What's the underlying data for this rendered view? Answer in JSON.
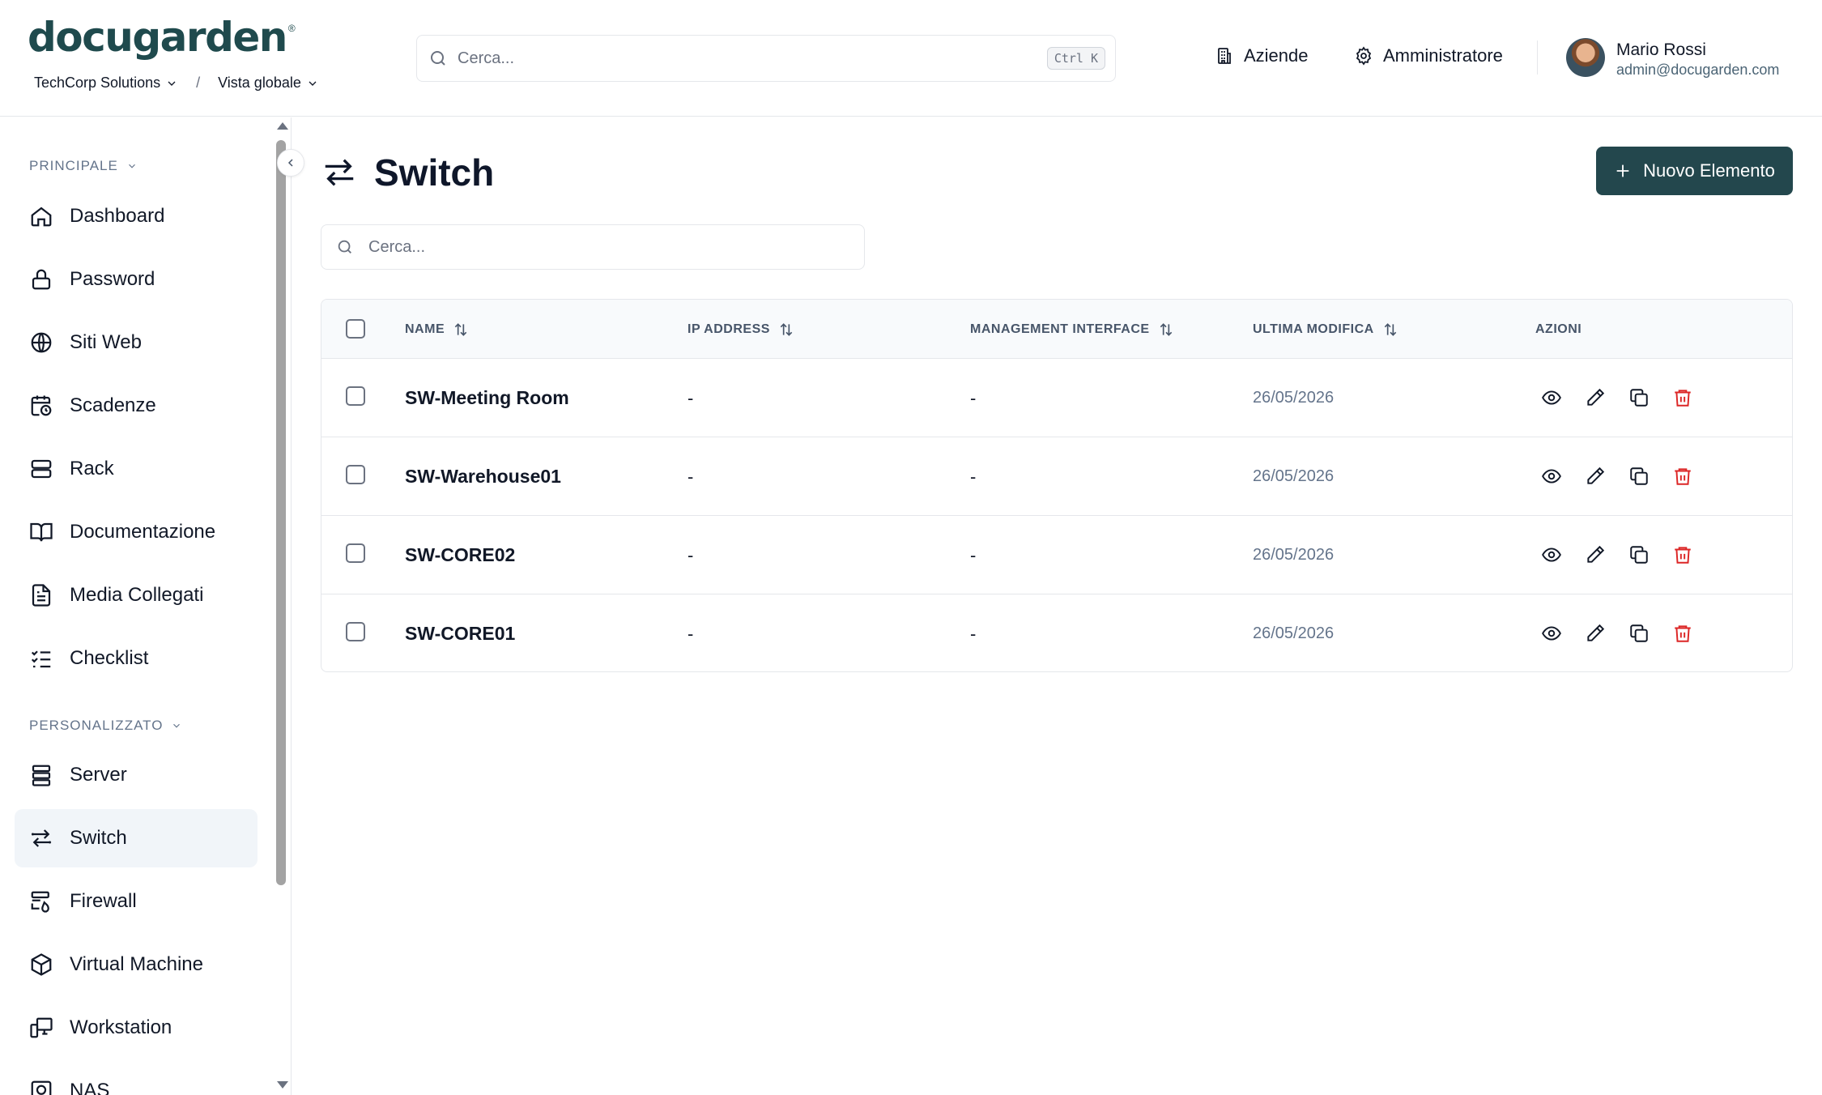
{
  "header": {
    "logo": "docugarden",
    "logo_mark": "®",
    "company": "TechCorp Solutions",
    "separator": "/",
    "view": "Vista globale",
    "search_placeholder": "Cerca...",
    "shortcut": "Ctrl K",
    "nav": [
      {
        "label": "Aziende",
        "icon": "building-icon"
      },
      {
        "label": "Amministratore",
        "icon": "gear-icon"
      }
    ],
    "user": {
      "name": "Mario Rossi",
      "email": "admin@docugarden.com"
    }
  },
  "sidebar": {
    "sections": [
      {
        "label": "PRINCIPALE",
        "items": [
          "Dashboard",
          "Password",
          "Siti Web",
          "Scadenze",
          "Rack",
          "Documentazione",
          "Media Collegati",
          "Checklist"
        ]
      },
      {
        "label": "PERSONALIZZATO",
        "items": [
          "Server",
          "Switch",
          "Firewall",
          "Virtual Machine",
          "Workstation",
          "NAS"
        ]
      }
    ],
    "active": "Switch"
  },
  "main": {
    "title": "Switch",
    "new_button": "Nuovo Elemento",
    "search_placeholder": "Cerca...",
    "table": {
      "columns": [
        "NAME",
        "IP ADDRESS",
        "MANAGEMENT INTERFACE",
        "ULTIMA MODIFICA",
        "AZIONI"
      ],
      "rows": [
        {
          "name": "SW-Meeting Room",
          "ip": "-",
          "mgmt": "-",
          "modified": "26/05/2026"
        },
        {
          "name": "SW-Warehouse01",
          "ip": "-",
          "mgmt": "-",
          "modified": "26/05/2026"
        },
        {
          "name": "SW-CORE02",
          "ip": "-",
          "mgmt": "-",
          "modified": "26/05/2026"
        },
        {
          "name": "SW-CORE01",
          "ip": "-",
          "mgmt": "-",
          "modified": "26/05/2026"
        }
      ]
    }
  },
  "colors": {
    "primary": "#23474d",
    "danger": "#dc2626",
    "logo": "#1f4a4d",
    "active_bg": "#f1f5f9"
  }
}
